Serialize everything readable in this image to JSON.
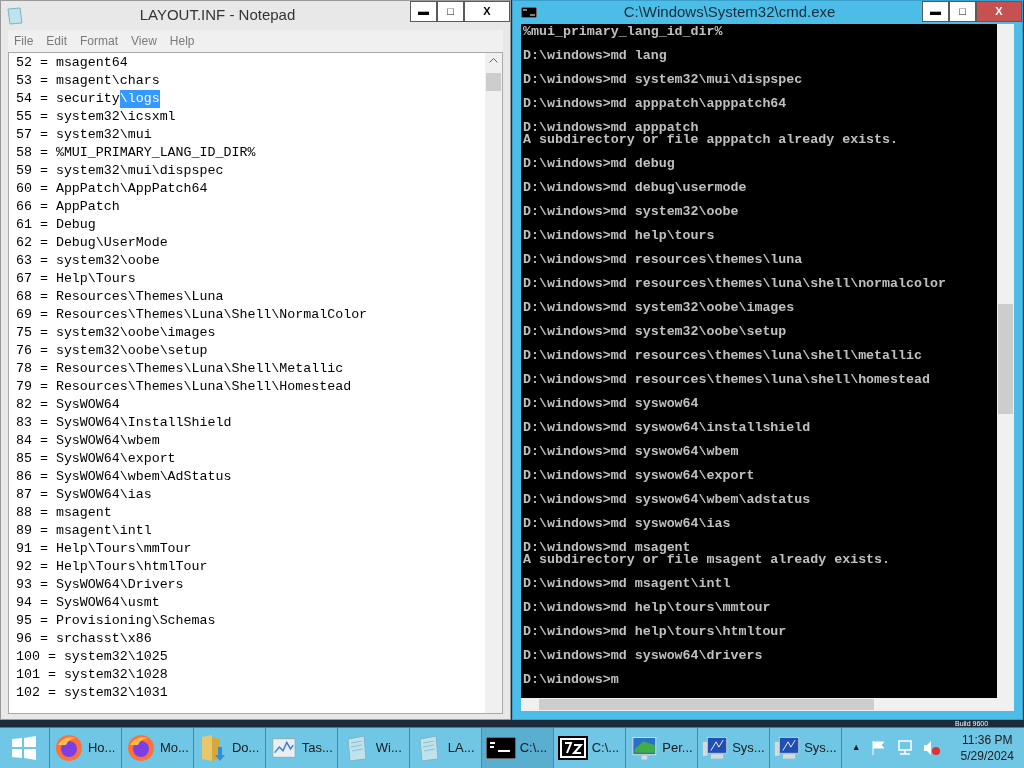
{
  "notepad": {
    "title": "LAYOUT.INF - Notepad",
    "controls": [
      "▬",
      "□",
      "X"
    ],
    "menu": [
      "File",
      "Edit",
      "Format",
      "View",
      "Help"
    ],
    "lines": [
      {
        "text": "52 = msagent64"
      },
      {
        "text": "53 = msagent\\chars"
      },
      {
        "text": "54 = security",
        "selection": "\\logs"
      },
      {
        "text": "55 = system32\\icsxml"
      },
      {
        "text": "57 = system32\\mui"
      },
      {
        "text": "58 = %MUI_PRIMARY_LANG_ID_DIR%"
      },
      {
        "text": "59 = system32\\mui\\dispspec"
      },
      {
        "text": "60 = AppPatch\\AppPatch64"
      },
      {
        "text": "66 = AppPatch"
      },
      {
        "text": "61 = Debug"
      },
      {
        "text": "62 = Debug\\UserMode"
      },
      {
        "text": "63 = system32\\oobe"
      },
      {
        "text": "67 = Help\\Tours"
      },
      {
        "text": "68 = Resources\\Themes\\Luna"
      },
      {
        "text": "69 = Resources\\Themes\\Luna\\Shell\\NormalColor"
      },
      {
        "text": "75 = system32\\oobe\\images"
      },
      {
        "text": "76 = system32\\oobe\\setup"
      },
      {
        "text": "78 = Resources\\Themes\\Luna\\Shell\\Metallic"
      },
      {
        "text": "79 = Resources\\Themes\\Luna\\Shell\\Homestead"
      },
      {
        "text": "82 = SysWOW64"
      },
      {
        "text": "83 = SysWOW64\\InstallShield"
      },
      {
        "text": "84 = SysWOW64\\wbem"
      },
      {
        "text": "85 = SysWOW64\\export"
      },
      {
        "text": "86 = SysWOW64\\wbem\\AdStatus"
      },
      {
        "text": "87 = SysWOW64\\ias"
      },
      {
        "text": "88 = msagent"
      },
      {
        "text": "89 = msagent\\intl"
      },
      {
        "text": "91 = Help\\Tours\\mmTour"
      },
      {
        "text": "92 = Help\\Tours\\htmlTour"
      },
      {
        "text": "93 = SysWOW64\\Drivers"
      },
      {
        "text": "94 = SysWOW64\\usmt"
      },
      {
        "text": "95 = Provisioning\\Schemas"
      },
      {
        "text": "96 = srchasst\\x86"
      },
      {
        "text": "100 = system32\\1025"
      },
      {
        "text": "101 = system32\\1028"
      },
      {
        "text": "102 = system32\\1031"
      }
    ]
  },
  "cmd": {
    "title": "C:\\Windows\\System32\\cmd.exe",
    "controls": [
      "▬",
      "□",
      "X"
    ],
    "blocks": [
      [
        "%mui_primary_lang_id_dir%"
      ],
      [
        "D:\\windows>md lang"
      ],
      [
        "D:\\windows>md system32\\mui\\dispspec"
      ],
      [
        "D:\\windows>md apppatch\\apppatch64"
      ],
      [
        "D:\\windows>md apppatch",
        "A subdirectory or file apppatch already exists."
      ],
      [
        "D:\\windows>md debug"
      ],
      [
        "D:\\windows>md debug\\usermode"
      ],
      [
        "D:\\windows>md system32\\oobe"
      ],
      [
        "D:\\windows>md help\\tours"
      ],
      [
        "D:\\windows>md resources\\themes\\luna"
      ],
      [
        "D:\\windows>md resources\\themes\\luna\\shell\\normalcolor"
      ],
      [
        "D:\\windows>md system32\\oobe\\images"
      ],
      [
        "D:\\windows>md system32\\oobe\\setup"
      ],
      [
        "D:\\windows>md resources\\themes\\luna\\shell\\metallic"
      ],
      [
        "D:\\windows>md resources\\themes\\luna\\shell\\homestead"
      ],
      [
        "D:\\windows>md syswow64"
      ],
      [
        "D:\\windows>md syswow64\\installshield"
      ],
      [
        "D:\\windows>md syswow64\\wbem"
      ],
      [
        "D:\\windows>md syswow64\\export"
      ],
      [
        "D:\\windows>md syswow64\\wbem\\adstatus"
      ],
      [
        "D:\\windows>md syswow64\\ias"
      ],
      [
        "D:\\windows>md msagent",
        "A subdirectory or file msagent already exists."
      ],
      [
        "D:\\windows>md msagent\\intl"
      ],
      [
        "D:\\windows>md help\\tours\\mmtour"
      ],
      [
        "D:\\windows>md help\\tours\\htmltour"
      ],
      [
        "D:\\windows>md syswow64\\drivers"
      ],
      [
        "D:\\windows>m"
      ]
    ]
  },
  "desktop": {
    "build_text": "Build 9600"
  },
  "taskbar": {
    "items": [
      {
        "kind": "firefox",
        "label": "Ho...",
        "selected": false
      },
      {
        "kind": "firefox",
        "label": "Mo...",
        "selected": false
      },
      {
        "kind": "folder",
        "label": "Do...",
        "selected": false
      },
      {
        "kind": "monitor",
        "label": "Tas...",
        "selected": false
      },
      {
        "kind": "notepad",
        "label": "Wi...",
        "selected": false
      },
      {
        "kind": "notepad",
        "label": "LA...",
        "selected": false
      },
      {
        "kind": "console",
        "label": "C:\\...",
        "selected": true
      },
      {
        "kind": "archive",
        "label": "C:\\...",
        "selected": false
      },
      {
        "kind": "perf",
        "label": "Per...",
        "selected": false
      },
      {
        "kind": "system",
        "label": "Sys...",
        "selected": false
      },
      {
        "kind": "system",
        "label": "Sys...",
        "selected": false
      }
    ],
    "tray_arrow": "▲",
    "time": "11:36 PM",
    "date": "5/29/2024"
  }
}
